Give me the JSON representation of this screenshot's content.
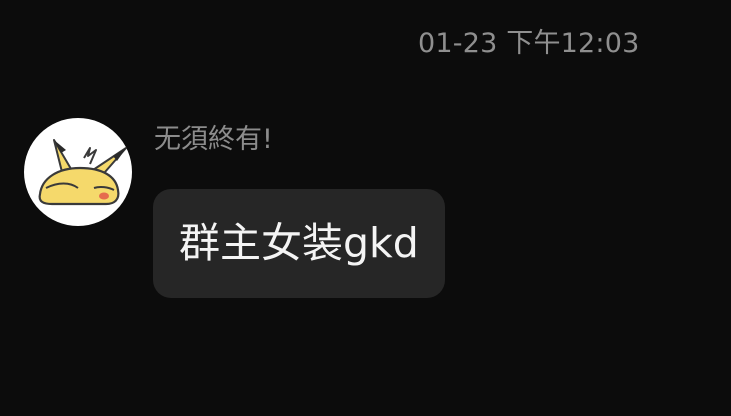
{
  "header": {
    "timestamp": "01-23 下午12:03"
  },
  "message": {
    "sender": "无須終有!",
    "text": "群主女装gkd",
    "avatar_icon": "pikachu-hood-icon"
  },
  "colors": {
    "background": "#0c0c0c",
    "timestamp_text": "#8f8f8f",
    "sender_text": "#8c8c8c",
    "bubble_background": "#262626",
    "bubble_text": "#f4f4f4",
    "avatar_yellow": "#f5d96b"
  }
}
